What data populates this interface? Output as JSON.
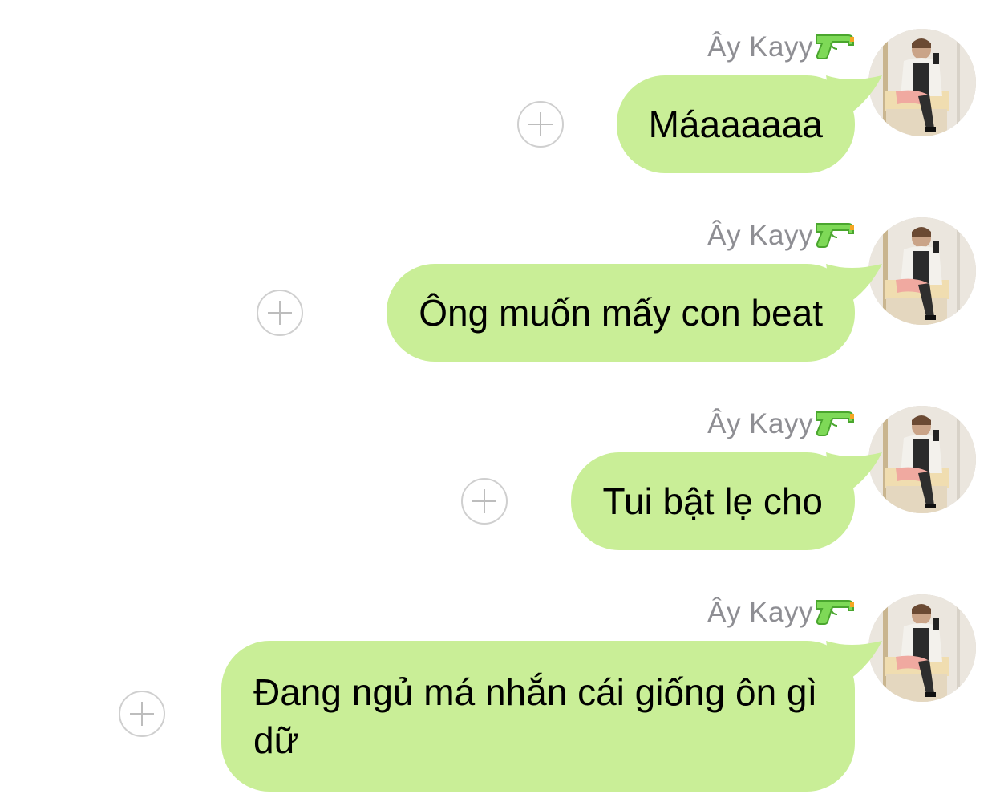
{
  "colors": {
    "bubble": "#c9ee97",
    "sender": "#8e8e93",
    "background": "#ffffff"
  },
  "messages": [
    {
      "sender": "Ây Kayy",
      "text": "Máaaaaaa"
    },
    {
      "sender": "Ây Kayy",
      "text": "Ông muốn mấy con beat"
    },
    {
      "sender": "Ây Kayy",
      "text": "Tui bật lẹ cho"
    },
    {
      "sender": "Ây Kayy",
      "text": "Đang ngủ má nhắn cái giống ôn gì dữ"
    }
  ],
  "icons": {
    "sender_emoji": "water-pistol-icon",
    "add": "add-reaction-icon"
  }
}
